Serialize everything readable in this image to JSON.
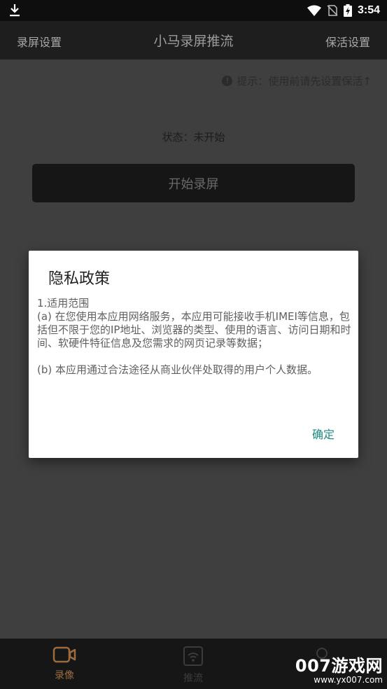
{
  "status_bar": {
    "time": "3:54"
  },
  "app_bar": {
    "left_label": "录屏设置",
    "title": "小马录屏推流",
    "right_label": "保活设置"
  },
  "main": {
    "tip_text": "提示：使用前请先设置保活↑",
    "status_text": "状态：未开始",
    "start_button_label": "开始录屏"
  },
  "dialog": {
    "title": "隐私政策",
    "lines": [
      "1.适用范围",
      "(a) 在您使用本应用网络服务，本应用可能接收手机IMEI等信息，包括但不限于您的IP地址、浏览器的类型、使用的语言、访问日期和时间、软硬件特征信息及您需求的网页记录等数据；",
      "(b) 本应用通过合法途径从商业伙伴处取得的用户个人数据。"
    ],
    "confirm_label": "确定"
  },
  "bottom_nav": {
    "items": [
      {
        "label": "录像",
        "icon": "video-camera-icon"
      },
      {
        "label": "推流",
        "icon": "wifi-stream-icon"
      },
      {
        "label": "",
        "icon": "person-icon"
      }
    ]
  },
  "watermark": {
    "big": "007游戏网",
    "small": "www.yx007.com"
  },
  "colors": {
    "accent_teal": "#1e8a80",
    "nav_active": "#9c6b3f",
    "dialog_bg": "#ffffff"
  }
}
